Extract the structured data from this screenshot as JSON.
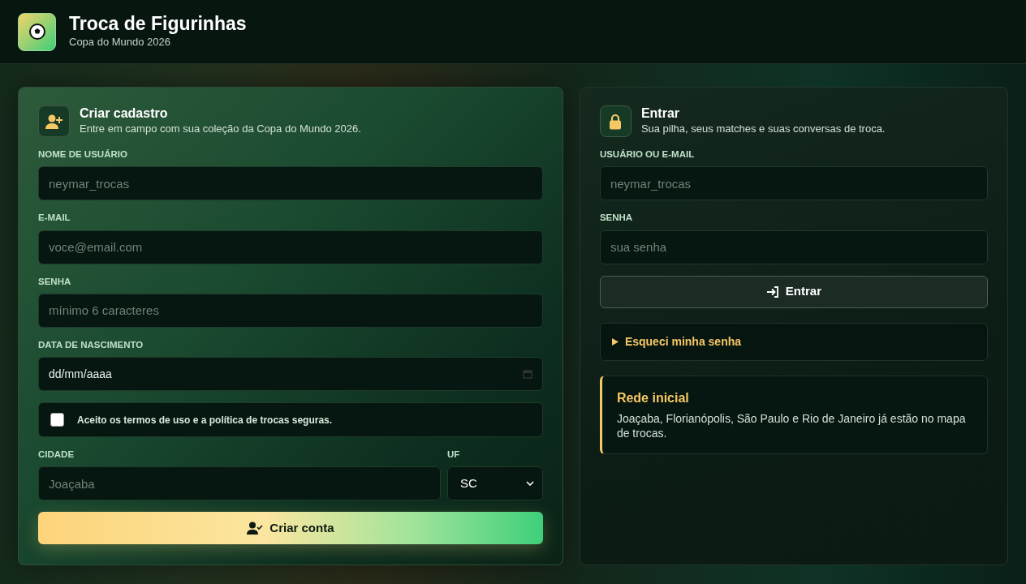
{
  "header": {
    "title": "Troca de Figurinhas",
    "subtitle": "Copa do Mundo 2026"
  },
  "signup": {
    "title": "Criar cadastro",
    "subtitle": "Entre em campo com sua coleção da Copa do Mundo 2026.",
    "fields": [
      {
        "kind": "text",
        "label": "NOME DE USUÁRIO",
        "placeholder": "neymar_trocas"
      },
      {
        "kind": "text",
        "label": "E-MAIL",
        "placeholder": "voce@email.com"
      },
      {
        "kind": "text",
        "label": "SENHA",
        "placeholder": "mínimo 6 caracteres"
      },
      {
        "kind": "date",
        "label": "DATA DE NASCIMENTO",
        "value": "dd/mm/aaaa"
      }
    ],
    "terms": {
      "label": "Aceito os termos de uso e a política de trocas seguras.",
      "checked": false
    },
    "city": {
      "label": "CIDADE",
      "placeholder": "Joaçaba"
    },
    "state": {
      "label": "UF",
      "value": "SC"
    },
    "button": "Criar conta"
  },
  "login": {
    "title": "Entrar",
    "subtitle": "Sua pilha, seus matches e suas conversas de troca.",
    "fields": [
      {
        "kind": "text",
        "label": "USUÁRIO OU E-MAIL",
        "placeholder": "neymar_trocas"
      },
      {
        "kind": "text",
        "label": "SENHA",
        "placeholder": "sua senha"
      }
    ],
    "button": "Entrar",
    "forgot": {
      "label": "Esqueci minha senha",
      "expanded": false
    },
    "note": {
      "title": "Rede inicial",
      "text": "Joaçaba, Florianópolis, São Paulo e Rio de Janeiro já estão no mapa de trocas."
    }
  }
}
